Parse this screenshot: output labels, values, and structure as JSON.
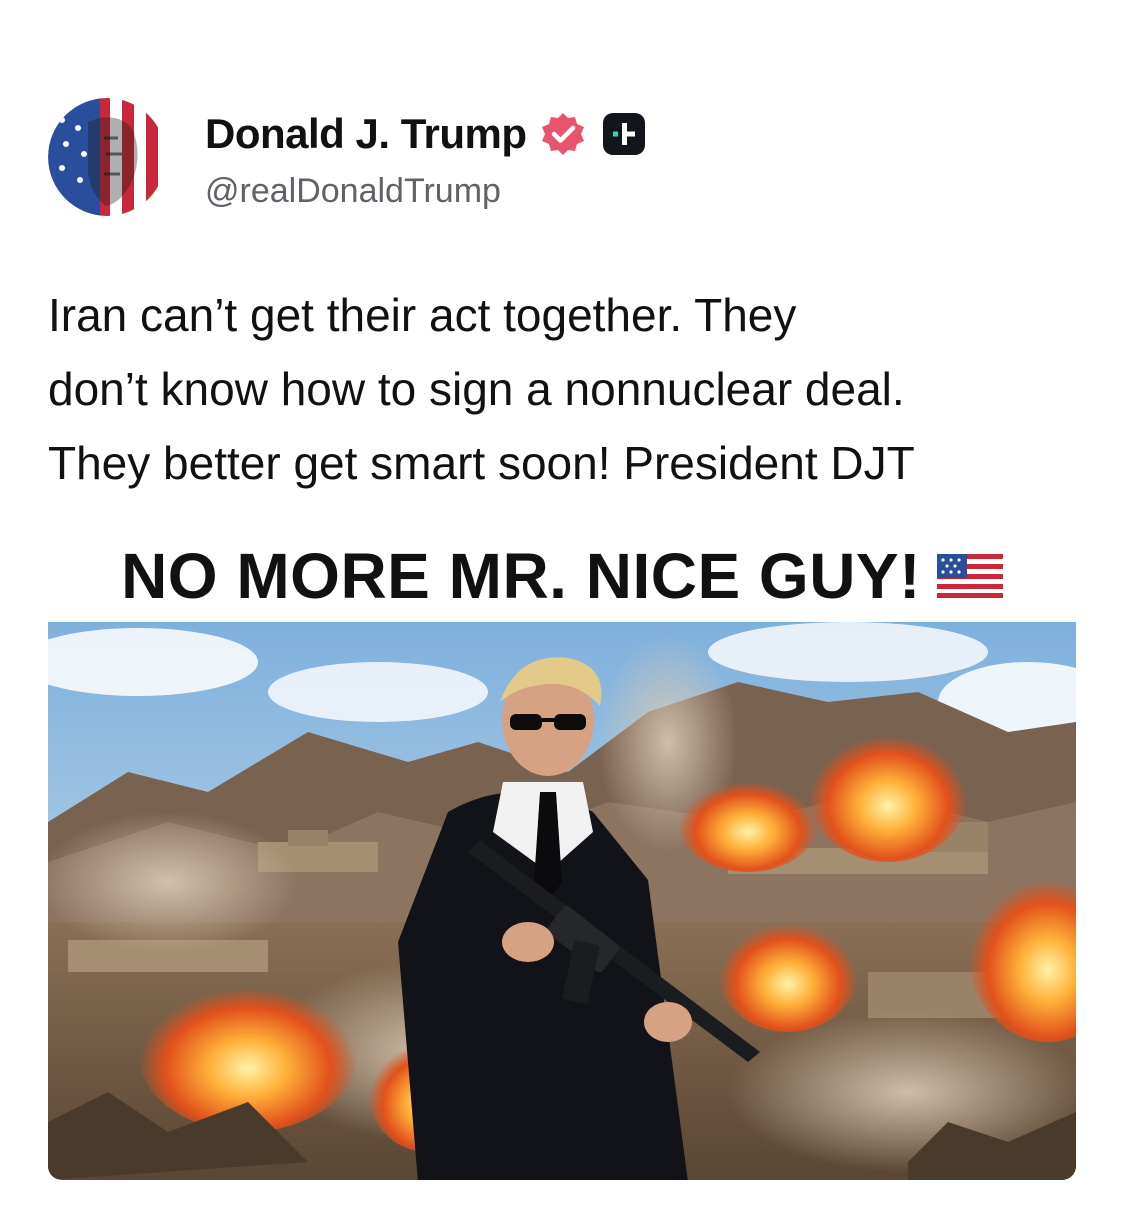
{
  "post": {
    "author": {
      "display_name": "Donald J. Trump",
      "handle": "@realDonaldTrump",
      "verified": true,
      "avatar_icon": "flag-painted-portrait-avatar"
    },
    "text_lines": [
      "Iran can’t get their act together. They",
      "don’t know how to sign a nonnuclear deal.",
      "They better get smart soon! President DJT"
    ],
    "media": {
      "caption": "NO MORE MR. NICE GUY!",
      "caption_emoji_icon": "us-flag-icon"
    }
  },
  "colors": {
    "verified_badge": "#e8546e",
    "plus_badge_bg": "#12151b",
    "plus_badge_accent": "#2fd6b5",
    "handle_text": "#5f6368"
  }
}
